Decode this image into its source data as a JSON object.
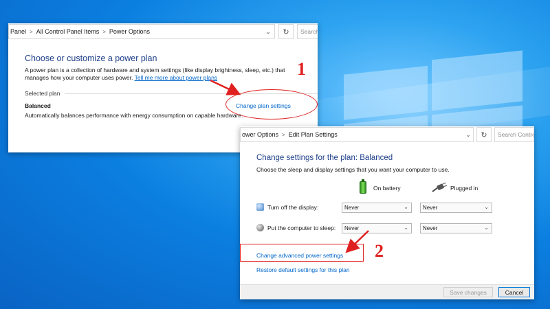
{
  "window1": {
    "breadcrumb": [
      "Panel",
      "All Control Panel Items",
      "Power Options"
    ],
    "search_placeholder": "Search",
    "heading": "Choose or customize a power plan",
    "intro_line1": "A power plan is a collection of hardware and system settings (like display brightness, sleep, etc.) that",
    "intro_line2_prefix": "manages how your computer uses power.",
    "intro_link": "Tell me more about power plans",
    "selected_plan_label": "Selected plan",
    "plan_name": "Balanced",
    "plan_description": "Automatically balances performance with energy consumption on capable hardware.",
    "change_plan_link": "Change plan settings",
    "step_number": "1"
  },
  "window2": {
    "breadcrumb": [
      "ower Options",
      "Edit Plan Settings"
    ],
    "search_placeholder": "Search Contro",
    "heading": "Change settings for the plan: Balanced",
    "subheading": "Choose the sleep and display settings that you want your computer to use.",
    "col_battery": "On battery",
    "col_plugged": "Plugged in",
    "rows": [
      {
        "label": "Turn off the display:",
        "battery": "Never",
        "plugged": "Never"
      },
      {
        "label": "Put the computer to sleep:",
        "battery": "Never",
        "plugged": "Never"
      }
    ],
    "advanced_link": "Change advanced power settings",
    "restore_link": "Restore default settings for this plan",
    "save_button": "Save changes",
    "cancel_button": "Cancel",
    "step_number": "2"
  },
  "colors": {
    "heading": "#1e3f8a",
    "link": "#0066cc",
    "annotation": "#e02020",
    "desktop": "#0b7fe0"
  }
}
